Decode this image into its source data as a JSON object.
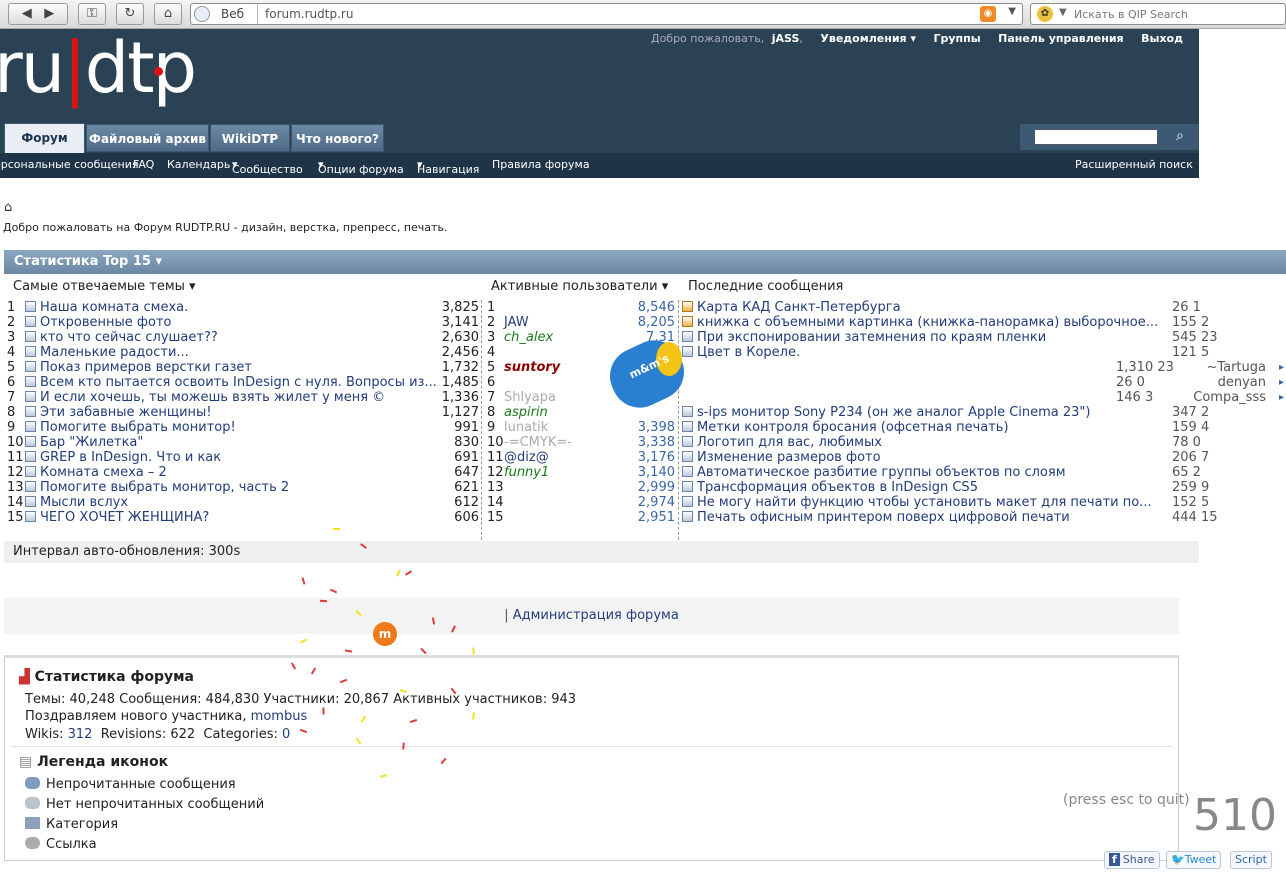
{
  "browser": {
    "web_label": "Веб",
    "url": "forum.rudtp.ru",
    "search_placeholder": "Искать в QIP Search"
  },
  "header": {
    "logo": "ru|dtp",
    "welcome_prefix": "Добро пожаловать,",
    "username": "jASS",
    "notifications": "Уведомления",
    "groups": "Группы",
    "control_panel": "Панель управления",
    "logout": "Выход"
  },
  "tabs": [
    "Форум",
    "Файловый архив",
    "WikiDTP",
    "Что нового?"
  ],
  "subnav": [
    "ерсональные сообщения",
    "FAQ",
    "Календарь",
    "Сообщество",
    "Опции форума",
    "Навигация",
    "Правила форума"
  ],
  "advanced_search": "Расширенный поиск",
  "welcome_text": "Добро пожаловать на Форум RUDTP.RU - дизайн, верстка, препресс, печать.",
  "stats": {
    "title": "Статистика Top 15",
    "col_threads": "Самые отвечаемые темы",
    "col_users": "Активные пользователи",
    "col_recent": "Последние сообщения",
    "threads": [
      {
        "n": "1",
        "t": "Наша комната смеха.",
        "c": "3,825"
      },
      {
        "n": "2",
        "t": "Откровенные фото",
        "c": "3,141"
      },
      {
        "n": "3",
        "t": "кто что сейчас слушает??",
        "c": "2,630"
      },
      {
        "n": "4",
        "t": "Маленькие радости...",
        "c": "2,456"
      },
      {
        "n": "5",
        "t": "Показ примеров верстки газет",
        "c": "1,732"
      },
      {
        "n": "6",
        "t": "Всем кто пытается освоить InDesign с нуля. Вопросы из...",
        "c": "1,485"
      },
      {
        "n": "7",
        "t": "И если хочешь, ты можешь взять жилет у меня ©",
        "c": "1,336"
      },
      {
        "n": "8",
        "t": "Эти забавные женщины!",
        "c": "1,127"
      },
      {
        "n": "9",
        "t": "Помогите выбрать монитор!",
        "c": "991"
      },
      {
        "n": "10",
        "t": "Бар \"Жилетка\"",
        "c": "830"
      },
      {
        "n": "11",
        "t": "GREP в InDesign. Что и как",
        "c": "691"
      },
      {
        "n": "12",
        "t": "Комната смеха – 2",
        "c": "647"
      },
      {
        "n": "13",
        "t": "Помогите выбрать монитор, часть 2",
        "c": "621"
      },
      {
        "n": "14",
        "t": "Мысли вслух",
        "c": "612"
      },
      {
        "n": "15",
        "t": "ЧЕГО ХОЧЕТ ЖЕНЩИНА?",
        "c": "606"
      }
    ],
    "users": [
      {
        "n": "1",
        "u": "",
        "c": "8,546"
      },
      {
        "n": "2",
        "u": "JAW",
        "c": "8,205"
      },
      {
        "n": "3",
        "u": "ch_alex",
        "c": "7,31"
      },
      {
        "n": "4",
        "u": "",
        "c": ""
      },
      {
        "n": "5",
        "u": "suntory",
        "c": ""
      },
      {
        "n": "6",
        "u": "",
        "c": ""
      },
      {
        "n": "7",
        "u": "Shlyapa",
        "c": ""
      },
      {
        "n": "8",
        "u": "aspirin",
        "c": ""
      },
      {
        "n": "9",
        "u": "lunatik",
        "c": "3,398"
      },
      {
        "n": "10",
        "u": "-=CMYK=-",
        "c": "3,338"
      },
      {
        "n": "11",
        "u": "@diz@",
        "c": "3,176"
      },
      {
        "n": "12",
        "u": "funny1",
        "c": "3,140"
      },
      {
        "n": "13",
        "u": "",
        "c": "2,999"
      },
      {
        "n": "14",
        "u": "",
        "c": "2,974"
      },
      {
        "n": "15",
        "u": "",
        "c": "2,951"
      }
    ],
    "recent": [
      {
        "t": "Карта КАД Санкт-Петербурга",
        "v": "26 1",
        "u": "",
        "new": true
      },
      {
        "t": "книжка с объемными картинка (книжка-панорамка) выборочное...",
        "v": "155 2",
        "u": "",
        "new": true
      },
      {
        "t": "При экспонировании затемнения по краям пленки",
        "v": "545 23",
        "u": "",
        "new": false
      },
      {
        "t": "Цвет в Кореле.",
        "v": "121 5",
        "u": "",
        "new": false
      },
      {
        "t": "",
        "v": "1,310 23",
        "u": "~Tartuga",
        "new": false
      },
      {
        "t": "",
        "v": "26 0",
        "u": "denyan",
        "new": false
      },
      {
        "t": "",
        "v": "146 3",
        "u": "Compa_sss",
        "new": false
      },
      {
        "t": "s-ips монитор Sony P234 (он же аналог Apple Cinema 23\")",
        "v": "347 2",
        "u": "",
        "new": false
      },
      {
        "t": "Метки контроля бросания (офсетная печать)",
        "v": "159 4",
        "u": "",
        "new": false
      },
      {
        "t": "Логотип для вас, любимых",
        "v": "78 0",
        "u": "",
        "new": false
      },
      {
        "t": "Изменение размеров фото",
        "v": "206 7",
        "u": "",
        "new": false
      },
      {
        "t": "Автоматическое разбитие группы объектов по слоям",
        "v": "65 2",
        "u": "",
        "new": false
      },
      {
        "t": "Трансформация объектов в InDesign CS5",
        "v": "259 9",
        "u": "",
        "new": false
      },
      {
        "t": "Не могу найти функцию чтобы установить макет для печати по...",
        "v": "152 5",
        "u": "",
        "new": false
      },
      {
        "t": "Печать офисным принтером поверх цифровой печати",
        "v": "444 15",
        "u": "",
        "new": false
      }
    ]
  },
  "interval": "Интервал авто-обновления: 300s",
  "admin_link": "Администрация форума",
  "forum_stats": {
    "title": "Статистика форума",
    "line1": "Темы: 40,248  Сообщения: 484,830  Участники: 20,867  Активных участников: 943",
    "congrats": "Поздравляем нового участника,",
    "new_member": "mombus",
    "wikis_label": "Wikis:",
    "wikis": "312",
    "revisions": "Revisions: 622",
    "categories_label": "Categories:",
    "categories": "0"
  },
  "legend": {
    "title": "Легенда иконок",
    "items": [
      "Непрочитанные сообщения",
      "Нет непрочитанных сообщений",
      "Категория",
      "Ссылка"
    ]
  },
  "overlay": {
    "quit": "(press esc to quit)",
    "count": "510",
    "share": "Share",
    "tweet": "Tweet",
    "script": "Script",
    "mm_label": "m&m's"
  }
}
